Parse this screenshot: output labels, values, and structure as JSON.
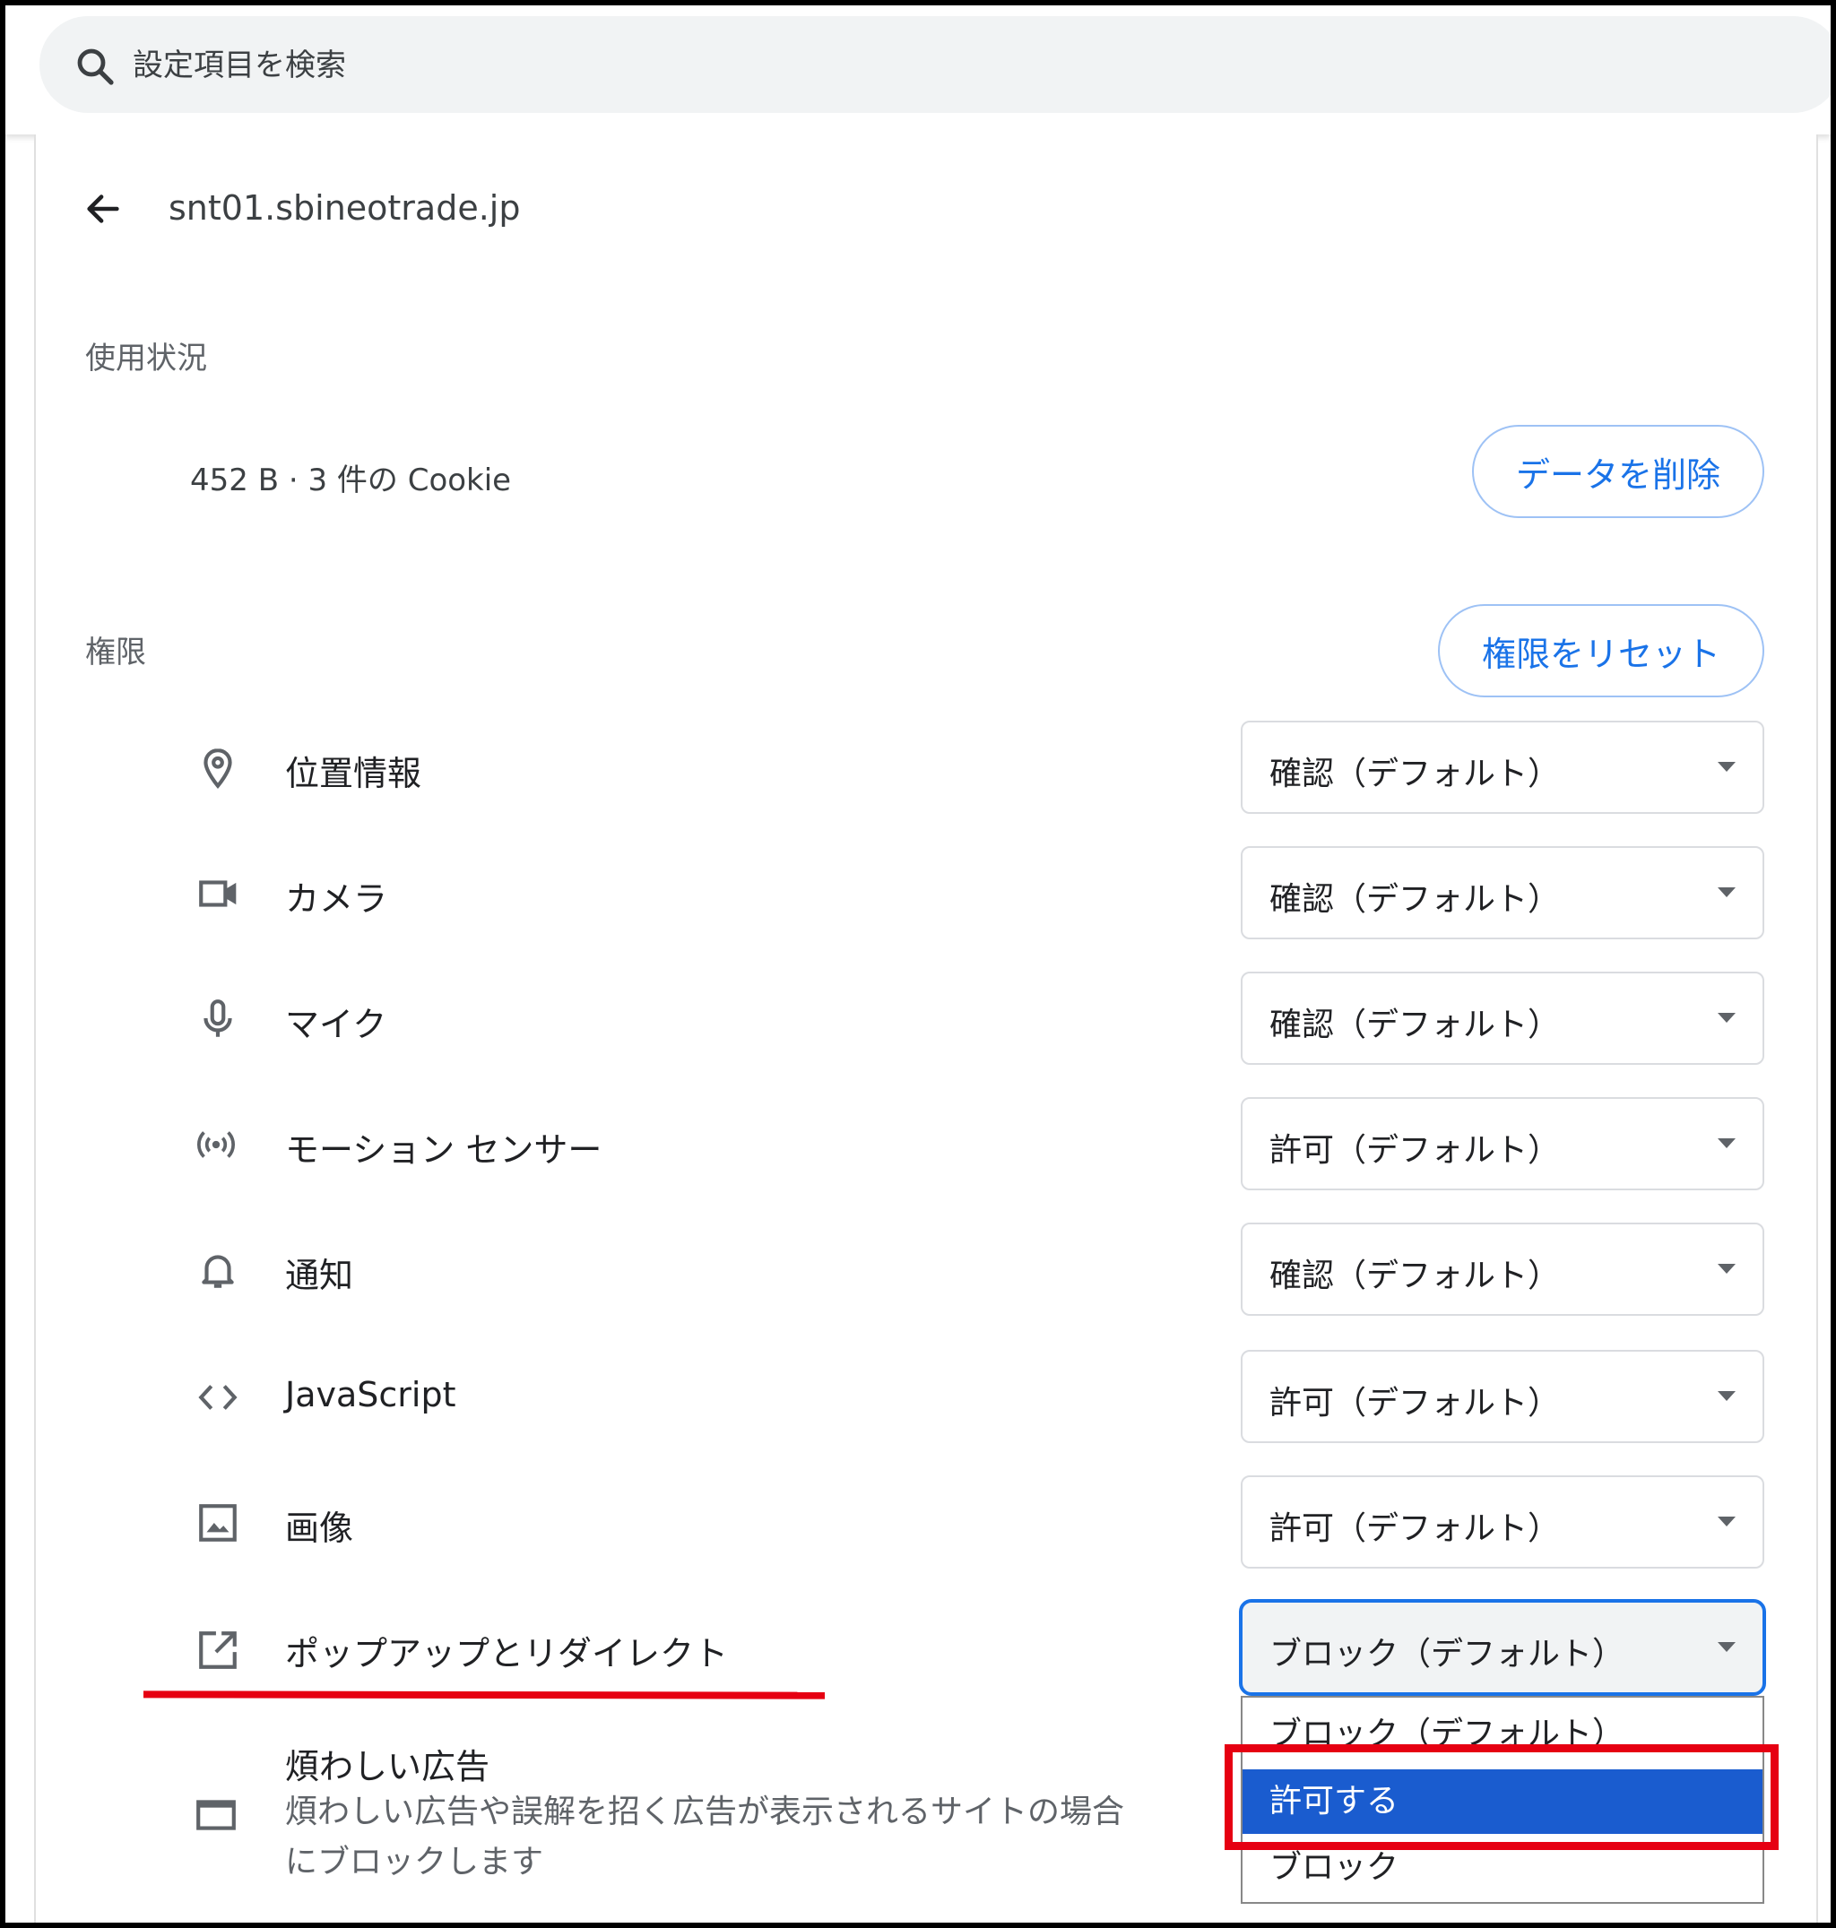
{
  "search": {
    "placeholder": "設定項目を検索"
  },
  "site": {
    "title": "snt01.sbineotrade.jp"
  },
  "usage": {
    "heading": "使用状況",
    "summary": "452 B · 3 件の Cookie",
    "delete_button": "データを削除"
  },
  "permissions": {
    "heading": "権限",
    "reset_button": "権限をリセット",
    "items": [
      {
        "icon": "location-pin-icon",
        "label": "位置情報",
        "value": "確認（デフォルト）"
      },
      {
        "icon": "camera-icon",
        "label": "カメラ",
        "value": "確認（デフォルト）"
      },
      {
        "icon": "microphone-icon",
        "label": "マイク",
        "value": "確認（デフォルト）"
      },
      {
        "icon": "motion-sensor-icon",
        "label": "モーション センサー",
        "value": "許可（デフォルト）"
      },
      {
        "icon": "bell-icon",
        "label": "通知",
        "value": "確認（デフォルト）"
      },
      {
        "icon": "code-icon",
        "label": "JavaScript",
        "value": "許可（デフォルト）"
      },
      {
        "icon": "image-icon",
        "label": "画像",
        "value": "許可（デフォルト）"
      },
      {
        "icon": "open-in-new-icon",
        "label": "ポップアップとリダイレクト",
        "value": "ブロック（デフォルト）"
      }
    ],
    "ads": {
      "icon": "ad-window-icon",
      "label": "煩わしい広告",
      "description_line1": "煩わしい広告や誤解を招く広告が表示されるサイトの場合",
      "description_line2": "にブロックします"
    }
  },
  "dropdown": {
    "options": [
      "ブロック（デフォルト）",
      "許可する",
      "ブロック"
    ],
    "highlighted": "許可する"
  },
  "colors": {
    "accent": "#1a73e8",
    "annotation_red": "#e60012",
    "selected_option": "#1a5ccf"
  }
}
